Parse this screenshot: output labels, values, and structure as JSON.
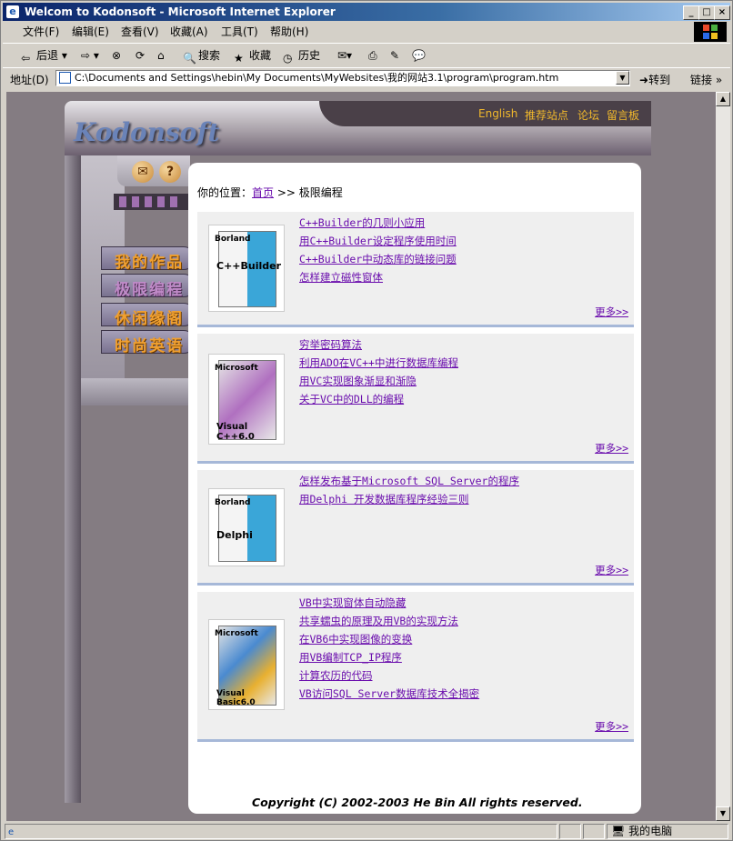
{
  "window": {
    "title": "Welcom to Kodonsoft - Microsoft Internet Explorer",
    "ie_logo": "e"
  },
  "menubar": [
    "文件(F)",
    "编辑(E)",
    "查看(V)",
    "收藏(A)",
    "工具(T)",
    "帮助(H)"
  ],
  "toolbar": {
    "back": "后退",
    "search": "搜索",
    "favorites": "收藏",
    "history": "历史"
  },
  "address": {
    "label": "地址(D)",
    "url": "C:\\Documents and Settings\\hebin\\My Documents\\MyWebsites\\我的网站3.1\\program\\program.htm",
    "go": "转到",
    "links": "链接"
  },
  "status": {
    "zone": "我的电脑"
  },
  "site": {
    "brand": "Kodonsoft",
    "top_links": [
      "English",
      "推荐站点",
      "论坛",
      "留言板"
    ],
    "icons": {
      "mail": "✉",
      "help": "?"
    },
    "nav": [
      "我的作品",
      "极限编程",
      "休闲缘阁",
      "时尚英语"
    ],
    "breadcrumb": {
      "label": "你的位置：",
      "home": "首页",
      "sep": ">>",
      "current": "极限编程"
    },
    "sections": [
      {
        "product": "C++Builder",
        "brand": "Borland",
        "links": [
          "C++Builder的几则小应用",
          "用C++Builder设定程序使用时间",
          "C++Builder中动态库的链接问题",
          "怎样建立磁性窗体"
        ],
        "more": "更多>>"
      },
      {
        "product": "Visual C++6.0",
        "brand": "Microsoft",
        "links": [
          "穷举密码算法",
          "利用ADO在VC++中进行数据库编程",
          "用VC实现图象渐显和渐隐",
          "关于VC中的DLL的编程"
        ],
        "more": "更多>>"
      },
      {
        "product": "Delphi",
        "brand": "Borland",
        "links": [
          "怎样发布基于Microsoft SQL Server的程序",
          "用Delphi 开发数据库程序经验三则"
        ],
        "more": "更多>>"
      },
      {
        "product": "Visual Basic6.0",
        "brand": "Microsoft",
        "links": [
          "VB中实现窗体自动隐藏",
          "共享蠕虫的原理及用VB的实现方法",
          "在VB6中实现图像的变换",
          "用VB编制TCP_IP程序",
          "计算农历的代码",
          "VB访问SQL Server数据库技术全揭密"
        ],
        "more": "更多>>"
      }
    ],
    "copyright": "Copyright (C) 2002-2003 He Bin  All rights reserved."
  }
}
